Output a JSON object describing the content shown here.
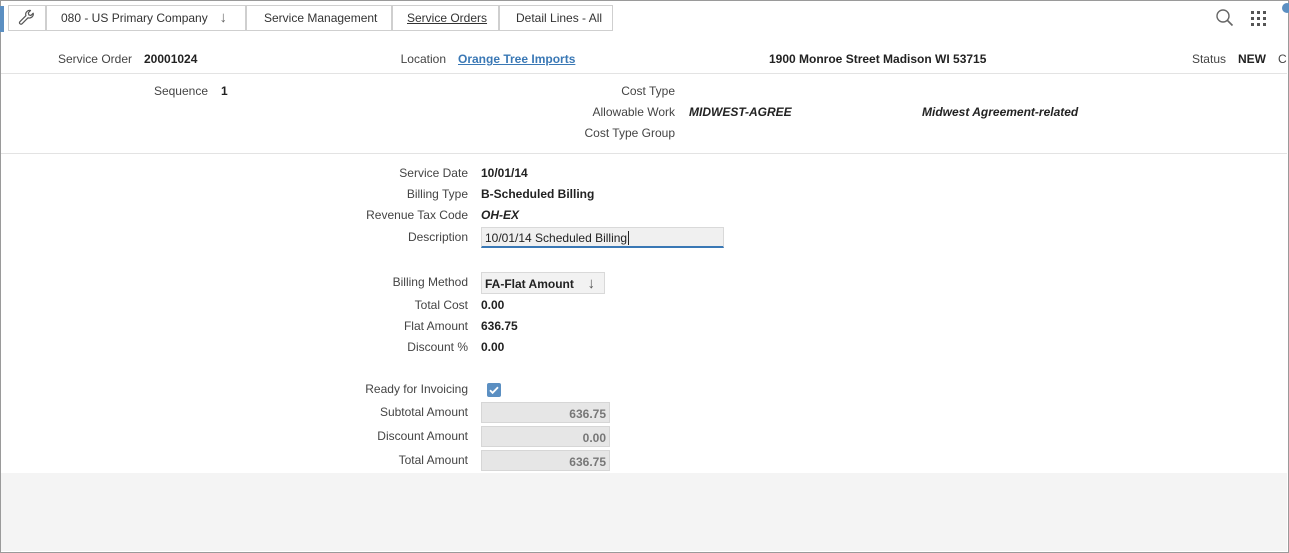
{
  "breadcrumb": {
    "company": "080 - US Primary Company",
    "module": "Service Management",
    "page": "Service Orders",
    "current": "Detail Lines - All"
  },
  "header": {
    "service_order_label": "Service Order",
    "service_order_value": "20001024",
    "location_label": "Location",
    "location_value": "Orange Tree Imports",
    "address": "1900 Monroe Street Madison WI 53715",
    "status_label": "Status",
    "status_value": "NEW",
    "overflow_char": "C"
  },
  "detail": {
    "sequence_label": "Sequence",
    "sequence_value": "1",
    "cost_type_label": "Cost Type",
    "allowable_work_label": "Allowable Work",
    "allowable_work_value": "MIDWEST-AGREE",
    "allowable_work_desc": "Midwest Agreement-related",
    "cost_type_group_label": "Cost Type Group"
  },
  "form": {
    "service_date_label": "Service Date",
    "service_date_value": "10/01/14",
    "billing_type_label": "Billing Type",
    "billing_type_value": "B-Scheduled Billing",
    "revenue_tax_label": "Revenue Tax Code",
    "revenue_tax_value": "OH-EX",
    "description_label": "Description",
    "description_value": "10/01/14 Scheduled Billing",
    "billing_method_label": "Billing Method",
    "billing_method_value": "FA-Flat Amount",
    "total_cost_label": "Total Cost",
    "total_cost_value": "0.00",
    "flat_amount_label": "Flat Amount",
    "flat_amount_value": "636.75",
    "discount_pct_label": "Discount %",
    "discount_pct_value": "0.00",
    "ready_label": "Ready for Invoicing",
    "ready_checked": true,
    "subtotal_label": "Subtotal Amount",
    "subtotal_value": "636.75",
    "discount_amount_label": "Discount Amount",
    "discount_amount_value": "0.00",
    "total_amount_label": "Total Amount",
    "total_amount_value": "636.75"
  },
  "colors": {
    "accent": "#3a78b5",
    "tab": "#5b8fc2"
  }
}
